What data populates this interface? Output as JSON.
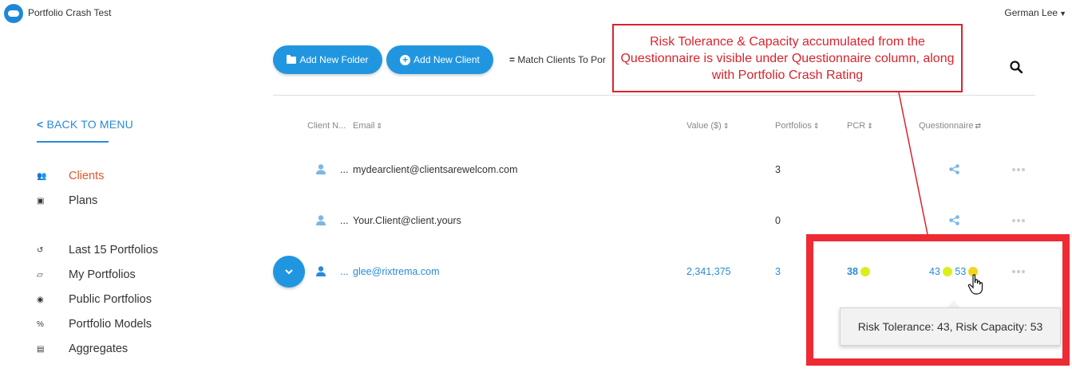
{
  "app": {
    "title": "Portfolio Crash Test",
    "user": "German Lee"
  },
  "toolbar": {
    "add_folder": "Add New Folder",
    "add_client": "Add New Client",
    "match_clients": "Match Clients To Por"
  },
  "sidebar": {
    "back": "BACK TO MENU",
    "items": [
      {
        "label": "Clients",
        "icon": "users-icon",
        "active": true
      },
      {
        "label": "Plans",
        "icon": "plans-icon"
      },
      {
        "label": "Last 15 Portfolios",
        "icon": "history-icon"
      },
      {
        "label": "My Portfolios",
        "icon": "folder-open-icon"
      },
      {
        "label": "Public Portfolios",
        "icon": "eye-icon"
      },
      {
        "label": "Portfolio Models",
        "icon": "percent-icon"
      },
      {
        "label": "Aggregates",
        "icon": "list-icon"
      }
    ]
  },
  "table": {
    "headers": {
      "client_name": "Client N...",
      "email": "Email",
      "value": "Value ($)",
      "portfolios": "Portfolios",
      "pcr": "PCR",
      "questionnaire": "Questionnaire"
    },
    "rows": [
      {
        "name": "...",
        "email": "mydearclient@clientsarewelcom.com",
        "value": "",
        "portfolios": "3"
      },
      {
        "name": "...",
        "email": "Your.Client@client.yours",
        "value": "",
        "portfolios": "0"
      },
      {
        "name": "...",
        "email": "glee@rixtrema.com",
        "value": "2,341,375",
        "portfolios": "3",
        "pcr": "38",
        "risk_tolerance": "43",
        "risk_capacity": "53"
      }
    ]
  },
  "annotation": {
    "text": "Risk Tolerance & Capacity accumulated from the Questionnaire is visible under Questionnaire column, along with Portfolio Crash Rating"
  },
  "tooltip": {
    "text": "Risk Tolerance: 43, Risk Capacity: 53"
  },
  "colors": {
    "accent": "#2196e0",
    "active_nav": "#e2562a",
    "annotation_red": "#ee2a32",
    "dot_yellow": "#d8ef1c"
  }
}
